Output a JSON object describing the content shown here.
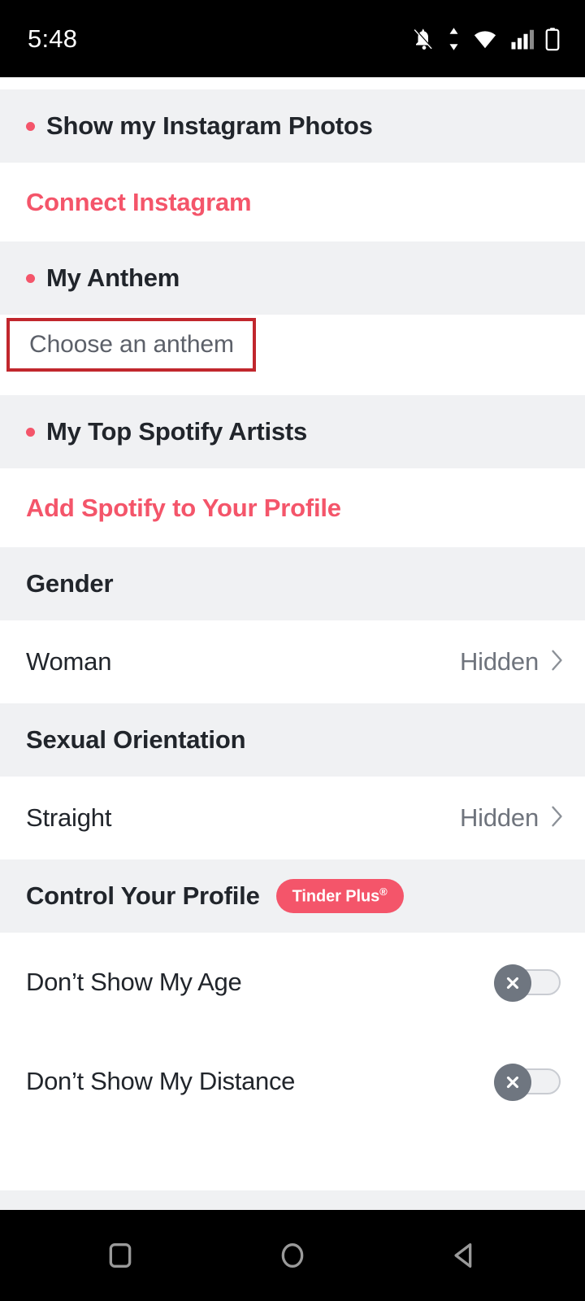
{
  "status_bar": {
    "time": "5:48",
    "icons": [
      "bell-muted-icon",
      "data-transfer-icon",
      "wifi-icon",
      "signal-icon",
      "battery-icon"
    ]
  },
  "sections": {
    "instagram": {
      "header": "Show my Instagram Photos",
      "action": "Connect Instagram"
    },
    "anthem": {
      "header": "My Anthem",
      "placeholder": "Choose an anthem"
    },
    "spotify": {
      "header": "My Top Spotify Artists",
      "action": "Add Spotify to Your Profile"
    },
    "gender": {
      "header": "Gender",
      "label": "Woman",
      "value": "Hidden"
    },
    "orientation": {
      "header": "Sexual Orientation",
      "label": "Straight",
      "value": "Hidden"
    },
    "control_profile": {
      "header": "Control Your Profile",
      "badge": "Tinder Plus",
      "badge_mark": "®",
      "toggles": [
        {
          "label": "Don’t Show My Age",
          "state": "off"
        },
        {
          "label": "Don’t Show My Distance",
          "state": "off"
        }
      ]
    }
  },
  "nav_bar": {
    "recents": "square-icon",
    "home": "circle-icon",
    "back": "triangle-back-icon"
  },
  "colors": {
    "accent": "#f4556a",
    "section_bg": "#f0f1f3",
    "text": "#21252b",
    "muted": "#6f747d",
    "annotation": "#c1272d"
  }
}
